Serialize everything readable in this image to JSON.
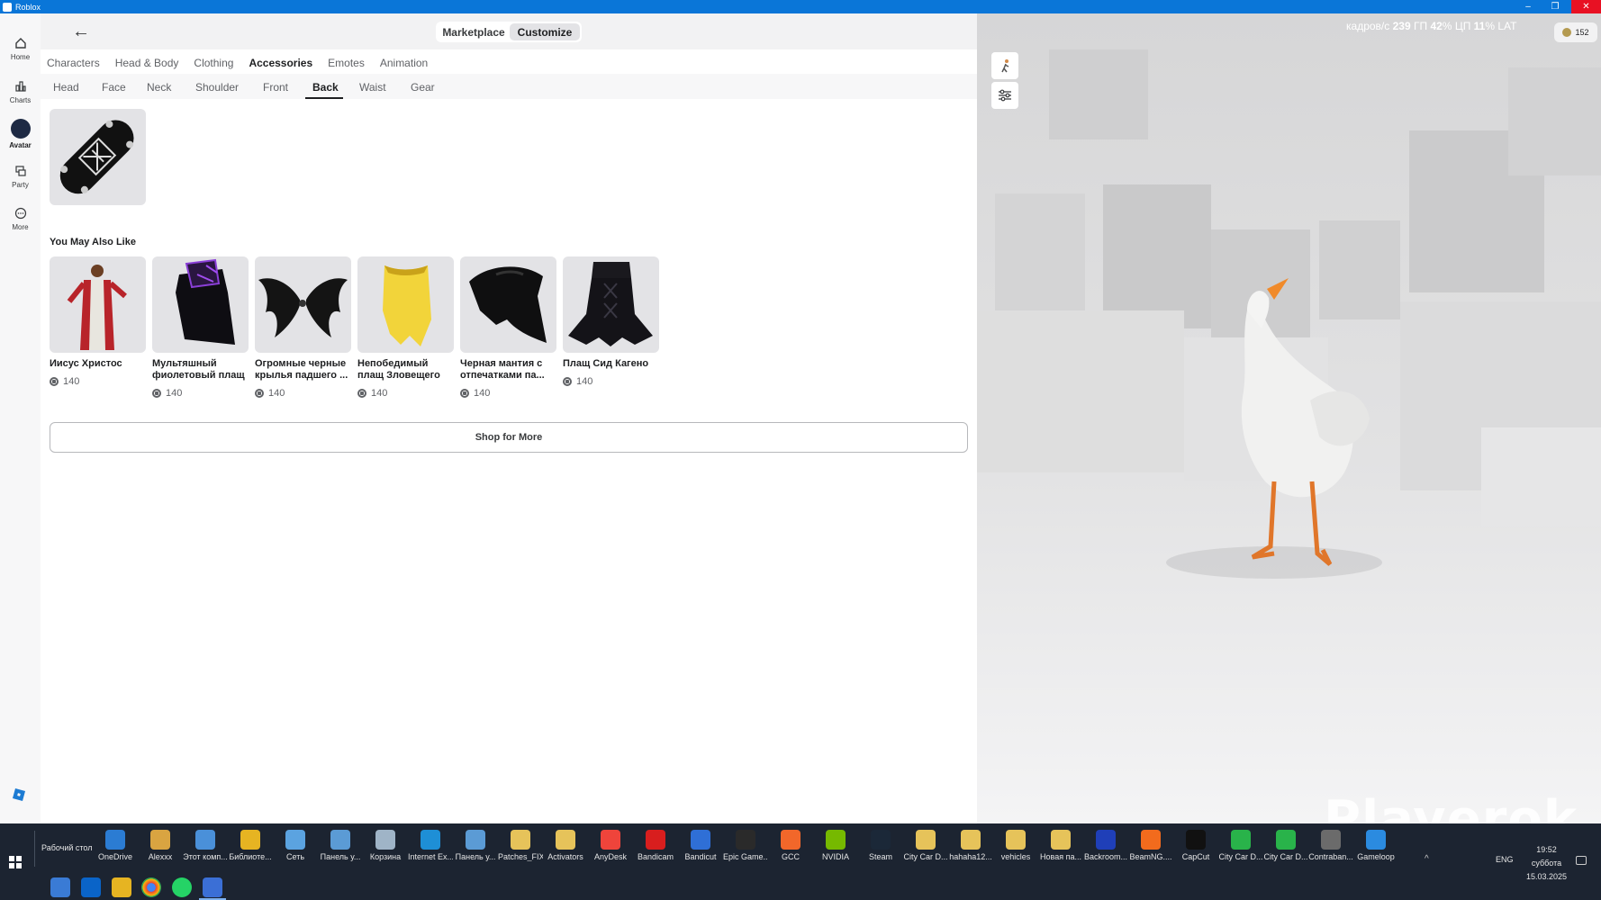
{
  "window": {
    "title": "Roblox"
  },
  "nav": {
    "items": [
      {
        "label": "Home",
        "icon": "home-icon"
      },
      {
        "label": "Charts",
        "icon": "charts-icon"
      },
      {
        "label": "Avatar",
        "icon": "avatar-icon"
      },
      {
        "label": "Party",
        "icon": "party-icon"
      },
      {
        "label": "More",
        "icon": "more-icon"
      }
    ]
  },
  "header": {
    "segment": {
      "marketplace": "Marketplace",
      "customize": "Customize",
      "selected": "Customize"
    }
  },
  "category_tabs": [
    "Characters",
    "Head & Body",
    "Clothing",
    "Accessories",
    "Emotes",
    "Animation"
  ],
  "category_active": "Accessories",
  "sub_tabs": [
    "Head",
    "Face",
    "Neck",
    "Shoulder",
    "Front",
    "Back",
    "Waist",
    "Gear"
  ],
  "sub_active": "Back",
  "equipped_item": {
    "name": "skateboard",
    "icon": "skateboard-image"
  },
  "recommendations": {
    "title": "You May Also Like",
    "items": [
      {
        "name": "Иисус Христос",
        "price": "140"
      },
      {
        "name": "Мультяшный фиолетовый плащ",
        "price": "140"
      },
      {
        "name": "Огромные черные крылья падшего ...",
        "price": "140"
      },
      {
        "name": "Непобедимый плащ Зловещего",
        "price": "140"
      },
      {
        "name": "Черная мантия с отпечатками па...",
        "price": "140"
      },
      {
        "name": "Плащ Сид Кагено",
        "price": "140"
      }
    ],
    "shop_more": "Shop for More"
  },
  "viewport": {
    "stats": {
      "fps_label": "кадров/с",
      "fps": "239",
      "gpu_label": "ГП",
      "gpu": "42",
      "cpu_label": "ЦП",
      "cpu": "11",
      "lat_label": "LAT",
      "pct": "%"
    },
    "robux": "152",
    "watermark": "Playerok"
  },
  "taskbar": {
    "desktop_label": "Рабочий стол",
    "apps": [
      {
        "label": "OneDrive",
        "color": "#2b7cd3"
      },
      {
        "label": "Alexxx",
        "color": "#d9a441"
      },
      {
        "label": "Этот комп...",
        "color": "#4a90d9"
      },
      {
        "label": "Библиоте...",
        "color": "#e6b422"
      },
      {
        "label": "Сеть",
        "color": "#5ba3e0"
      },
      {
        "label": "Панель у...",
        "color": "#5b9bd5"
      },
      {
        "label": "Корзина",
        "color": "#9fb4c7"
      },
      {
        "label": "Internet Ex...",
        "color": "#1e8fd6"
      },
      {
        "label": "Панель у...",
        "color": "#5b9bd5"
      },
      {
        "label": "Patches_FIX",
        "color": "#e6c35a"
      },
      {
        "label": "Activators",
        "color": "#e6c35a"
      },
      {
        "label": "AnyDesk",
        "color": "#ef443b"
      },
      {
        "label": "Bandicam",
        "color": "#d81e1e"
      },
      {
        "label": "Bandicut",
        "color": "#2f6fd6"
      },
      {
        "label": "Epic Game...",
        "color": "#2a2a2a"
      },
      {
        "label": "GCC",
        "color": "#f2672a"
      },
      {
        "label": "NVIDIA",
        "color": "#76b900"
      },
      {
        "label": "Steam",
        "color": "#1b2838"
      },
      {
        "label": "City Car D...",
        "color": "#e6c35a"
      },
      {
        "label": "hahaha12...",
        "color": "#e6c35a"
      },
      {
        "label": "vehicles",
        "color": "#e6c35a"
      },
      {
        "label": "Новая па...",
        "color": "#e6c35a"
      },
      {
        "label": "Backroom...",
        "color": "#1f3fb8"
      },
      {
        "label": "BeamNG....",
        "color": "#f26b1d"
      },
      {
        "label": "CapCut",
        "color": "#111111"
      },
      {
        "label": "City Car D...",
        "color": "#29b34a"
      },
      {
        "label": "City Car D...",
        "color": "#29b34a"
      },
      {
        "label": "Contraban...",
        "color": "#6b6b6b"
      },
      {
        "label": "Gameloop",
        "color": "#2b8be0"
      }
    ],
    "tray": {
      "lang": "ENG",
      "time": "19:52",
      "day": "суббота",
      "date": "15.03.2025"
    }
  }
}
